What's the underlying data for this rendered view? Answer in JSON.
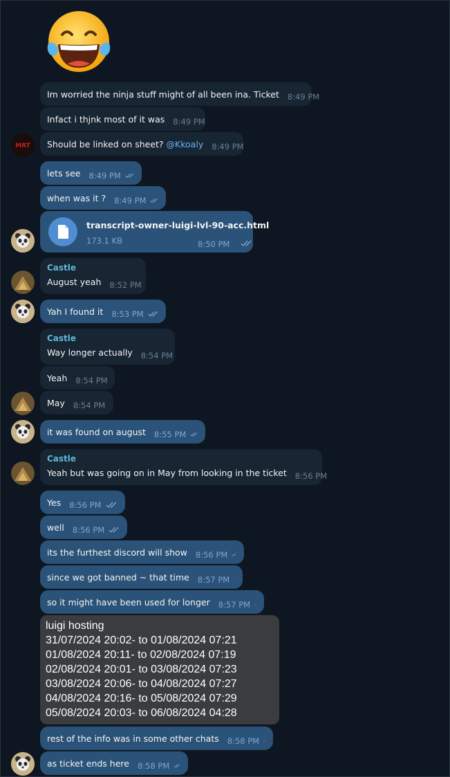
{
  "colors": {
    "background": "#0e1621",
    "incoming_bubble": "#182533",
    "outgoing_bubble": "#2b5278",
    "sender_name": "#5fb8d9",
    "mention": "#6ab3f3",
    "host_box": "#3a3c40"
  },
  "emoji": "face-with-tears-of-joy",
  "messages": [
    {
      "text": "Im worried the ninja stuff might of all been ina. Ticket",
      "time": "8:49 PM"
    },
    {
      "text": "Infact i thjnk most of it was",
      "time": "8:49 PM"
    },
    {
      "text": "Should be linked on sheet? ",
      "mention": "@Kkoaly",
      "time": "8:49 PM"
    },
    {
      "text": "lets see",
      "time": "8:49 PM"
    },
    {
      "text": "when was it ?",
      "time": "8:49 PM"
    },
    {
      "text": "August yeah",
      "sender": "Castle",
      "time": "8:52 PM"
    },
    {
      "text": "Yah I found it",
      "time": "8:53 PM"
    },
    {
      "text": "Way longer actually",
      "sender": "Castle",
      "time": "8:54 PM"
    },
    {
      "text": "Yeah",
      "time": "8:54 PM"
    },
    {
      "text": "May",
      "time": "8:54 PM"
    },
    {
      "text": "it was found on august",
      "time": "8:55 PM"
    },
    {
      "text": "Yeah but was going on in May from looking in the ticket",
      "sender": "Castle",
      "time": "8:56 PM"
    },
    {
      "text": "Yes",
      "time": "8:56 PM"
    },
    {
      "text": "well",
      "time": "8:56 PM"
    },
    {
      "text": "its the furthest discord will show",
      "time": "8:56 PM"
    },
    {
      "text": "since we got banned ~ that time",
      "time": "8:57 PM"
    },
    {
      "text": "so it might have been used for longer",
      "time": "8:57 PM"
    },
    {
      "text": "rest of the info was in some other chats",
      "time": "8:58 PM"
    },
    {
      "text": "as ticket ends here",
      "time": "8:58 PM"
    }
  ],
  "file": {
    "name": "transcript-owner-luigi-lvl-90-acc.html",
    "size": "173.1 KB",
    "time": "8:50 PM"
  },
  "hosting": {
    "title": "luigi hosting",
    "lines": [
      "31/07/2024 20:02- to 01/08/2024 07:21",
      "01/08/2024 20:11- to 02/08/2024 07:19",
      "02/08/2024 20:01- to 03/08/2024 07:23",
      "03/08/2024 20:06- to 04/08/2024 07:27",
      "04/08/2024 20:16- to 05/08/2024 07:29",
      "05/08/2024 20:03- to 06/08/2024 04:28"
    ]
  }
}
